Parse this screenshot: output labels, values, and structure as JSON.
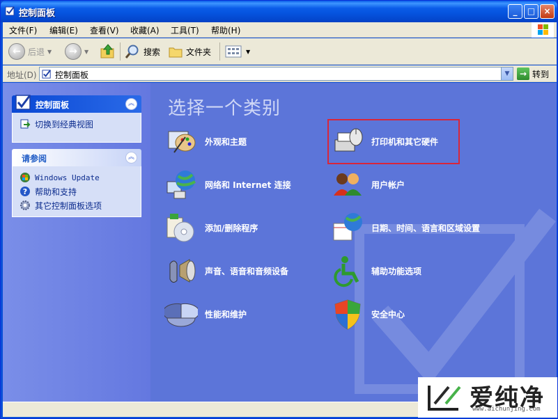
{
  "window": {
    "title": "控制面板",
    "buttons": {
      "minimize": "_",
      "maximize": "□",
      "close": "×"
    }
  },
  "menubar": {
    "items": [
      "文件(F)",
      "编辑(E)",
      "查看(V)",
      "收藏(A)",
      "工具(T)",
      "帮助(H)"
    ]
  },
  "toolbar": {
    "back_label": "后退",
    "search_label": "搜索",
    "folders_label": "文件夹"
  },
  "address": {
    "label": "地址(D)",
    "value": "控制面板",
    "go_label": "转到"
  },
  "sidebar": {
    "panel1": {
      "title": "控制面板",
      "links": [
        {
          "label": "切换到经典视图",
          "icon": "switch-view-icon"
        }
      ]
    },
    "panel2": {
      "title": "请参阅",
      "links": [
        {
          "label": "Windows Update",
          "icon": "windows-update-icon"
        },
        {
          "label": "帮助和支持",
          "icon": "help-icon"
        },
        {
          "label": "其它控制面板选项",
          "icon": "gear-icon"
        }
      ]
    }
  },
  "main": {
    "heading": "选择一个类别",
    "categories": [
      {
        "label": "外观和主题",
        "icon": "appearance-icon"
      },
      {
        "label": "打印机和其它硬件",
        "icon": "printer-icon"
      },
      {
        "label": "网络和 Internet 连接",
        "icon": "network-icon"
      },
      {
        "label": "用户帐户",
        "icon": "users-icon"
      },
      {
        "label": "添加/删除程序",
        "icon": "add-remove-icon"
      },
      {
        "label": "日期、时间、语言和区域设置",
        "icon": "datetime-icon"
      },
      {
        "label": "声音、语音和音频设备",
        "icon": "sound-icon"
      },
      {
        "label": "辅助功能选项",
        "icon": "accessibility-icon"
      },
      {
        "label": "性能和维护",
        "icon": "performance-icon"
      },
      {
        "label": "安全中心",
        "icon": "security-shield-icon"
      }
    ]
  },
  "watermark": {
    "brand": "爱纯净",
    "url": "www.aichunjing.com"
  }
}
